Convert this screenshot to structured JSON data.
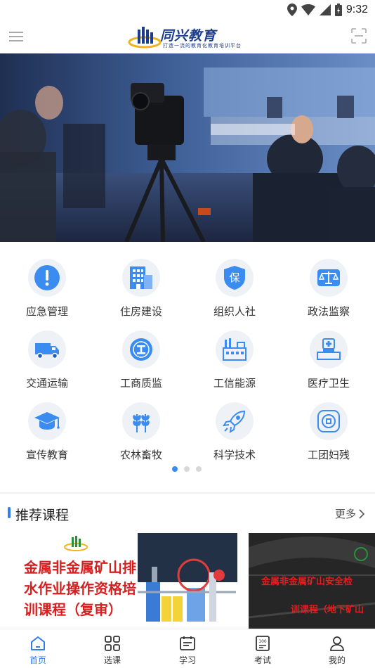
{
  "status_bar": {
    "time": "9:32"
  },
  "header": {
    "logo_name": "同兴教育",
    "logo_slogan": "打造一流的教育化教育培训平台"
  },
  "banner": {
    "slide_count": 2,
    "active_slide": 2
  },
  "categories": [
    {
      "label": "应急管理",
      "icon": "warning-icon"
    },
    {
      "label": "住房建设",
      "icon": "building-icon"
    },
    {
      "label": "组织人社",
      "icon": "shield-bao-icon"
    },
    {
      "label": "政法监察",
      "icon": "scales-icon"
    },
    {
      "label": "交通运输",
      "icon": "truck-icon"
    },
    {
      "label": "工商质监",
      "icon": "badge-icon"
    },
    {
      "label": "工信能源",
      "icon": "factory-icon"
    },
    {
      "label": "医疗卫生",
      "icon": "medical-icon"
    },
    {
      "label": "宣传教育",
      "icon": "graduation-cap-icon"
    },
    {
      "label": "农林畜牧",
      "icon": "wheat-icon"
    },
    {
      "label": "科学技术",
      "icon": "rocket-icon"
    },
    {
      "label": "工团妇残",
      "icon": "union-badge-icon"
    }
  ],
  "category_pages": {
    "count": 3,
    "active": 1
  },
  "recommended": {
    "title": "推荐课程",
    "more": "更多",
    "courses": [
      {
        "title": "金属非金属矿山排水作业操作资格培训课程（复审）"
      },
      {
        "line1": "金属非金属矿山安全检",
        "line2": "训课程（地下矿山"
      }
    ]
  },
  "tabs": [
    {
      "label": "首页",
      "icon": "home-icon",
      "active": true
    },
    {
      "label": "选课",
      "icon": "grid-icon",
      "active": false
    },
    {
      "label": "学习",
      "icon": "study-icon",
      "active": false
    },
    {
      "label": "考试",
      "icon": "exam-icon",
      "active": false
    },
    {
      "label": "我的",
      "icon": "user-icon",
      "active": false
    }
  ],
  "colors": {
    "accent": "#2f7ff0",
    "icon_blue": "#3b8cf0",
    "logo_navy": "#1a3d8f",
    "course_red": "#d81f1f"
  }
}
